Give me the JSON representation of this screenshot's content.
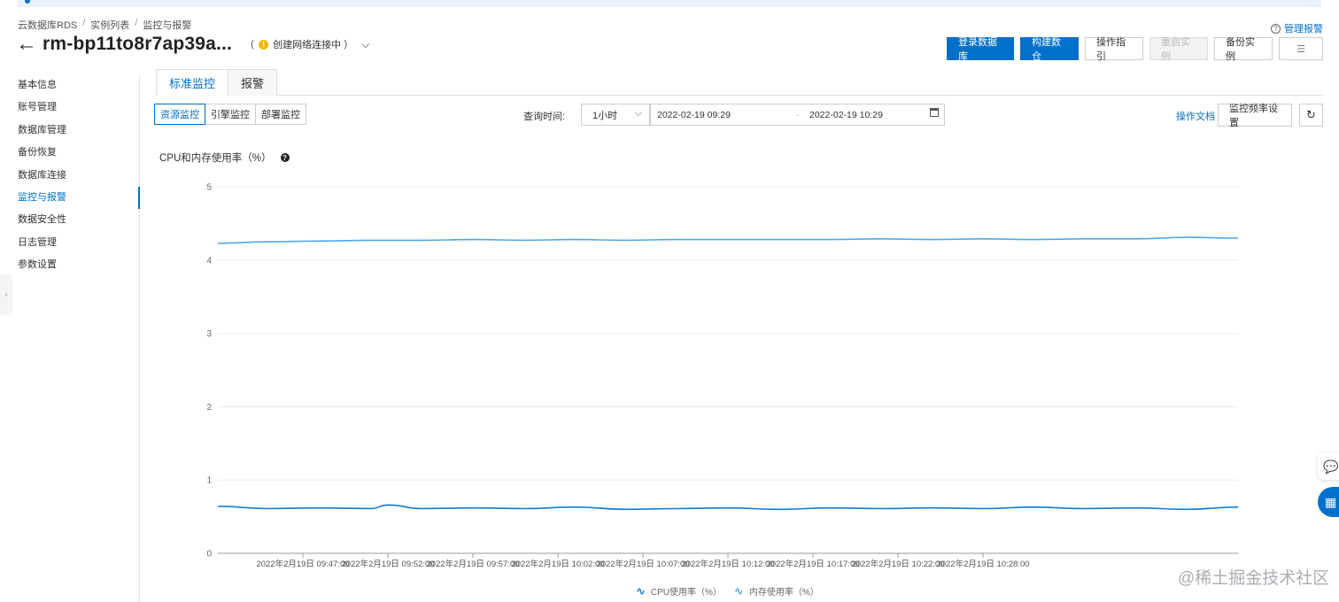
{
  "breadcrumb": [
    "云数据库RDS",
    "实例列表",
    "监控与报警"
  ],
  "header": {
    "instance_id": "rm-bp11to8r7ap39a...",
    "status": "创建网络连接中 ）",
    "manage_alert": "管理报警"
  },
  "actions": {
    "login_db": "登录数据库",
    "build_lake": "构建数仓",
    "guide": "操作指引",
    "restart": "重启实例",
    "backup": "备份实例"
  },
  "sidebar": {
    "items": [
      "基本信息",
      "账号管理",
      "数据库管理",
      "备份恢复",
      "数据库连接",
      "监控与报警",
      "数据安全性",
      "日志管理",
      "参数设置"
    ],
    "active_index": 5
  },
  "tabs": [
    "标准监控",
    "报警"
  ],
  "monitor_types": [
    "资源监控",
    "引擎监控",
    "部署监控"
  ],
  "query": {
    "label": "查询时间:",
    "range": "1小时",
    "start": "2022-02-19 09:29",
    "dash": "-",
    "end": "2022-02-19 10:29"
  },
  "toolbar": {
    "doc_link": "操作文档",
    "freq_settings": "监控频率设置"
  },
  "chart_data": {
    "type": "line",
    "title": "CPU和内存使用率（%）",
    "ylim": [
      0,
      5
    ],
    "yticks": [
      0,
      1,
      2,
      3,
      4,
      5
    ],
    "xlim": [
      0,
      60
    ],
    "xticks": [
      {
        "x": 5,
        "label": "2022年2月19日 09:47:00"
      },
      {
        "x": 10,
        "label": "2022年2月19日 09:52:00"
      },
      {
        "x": 15,
        "label": "2022年2月19日 09:57:00"
      },
      {
        "x": 20,
        "label": "2022年2月19日 10:02:00"
      },
      {
        "x": 25,
        "label": "2022年2月19日 10:07:00"
      },
      {
        "x": 30,
        "label": "2022年2月19日 10:12:00"
      },
      {
        "x": 35,
        "label": "2022年2月19日 10:17:00"
      },
      {
        "x": 40,
        "label": "2022年2月19日 10:22:00"
      },
      {
        "x": 45,
        "label": "2022年2月19日 10:28:00"
      }
    ],
    "grid": true,
    "legend": "bottom-center",
    "series": [
      {
        "name": "CPU使用率（%）",
        "color": "#0e7ad4",
        "x": [
          0,
          3,
          6,
          9,
          10,
          12,
          15,
          18,
          21,
          24,
          27,
          30,
          33,
          36,
          39,
          42,
          45,
          48,
          51,
          54,
          57,
          60
        ],
        "values": [
          0.64,
          0.61,
          0.62,
          0.61,
          0.66,
          0.61,
          0.62,
          0.61,
          0.63,
          0.6,
          0.61,
          0.62,
          0.6,
          0.62,
          0.61,
          0.62,
          0.61,
          0.63,
          0.61,
          0.62,
          0.6,
          0.63
        ]
      },
      {
        "name": "内存使用率（%）",
        "color": "#4fa8ee",
        "x": [
          0,
          3,
          6,
          9,
          12,
          15,
          18,
          21,
          24,
          27,
          30,
          33,
          36,
          39,
          42,
          45,
          48,
          51,
          54,
          57,
          60
        ],
        "values": [
          4.23,
          4.25,
          4.26,
          4.27,
          4.27,
          4.28,
          4.27,
          4.28,
          4.27,
          4.28,
          4.28,
          4.28,
          4.28,
          4.29,
          4.28,
          4.29,
          4.28,
          4.29,
          4.29,
          4.31,
          4.3
        ]
      }
    ]
  },
  "watermark": "@稀土掘金技术社区"
}
